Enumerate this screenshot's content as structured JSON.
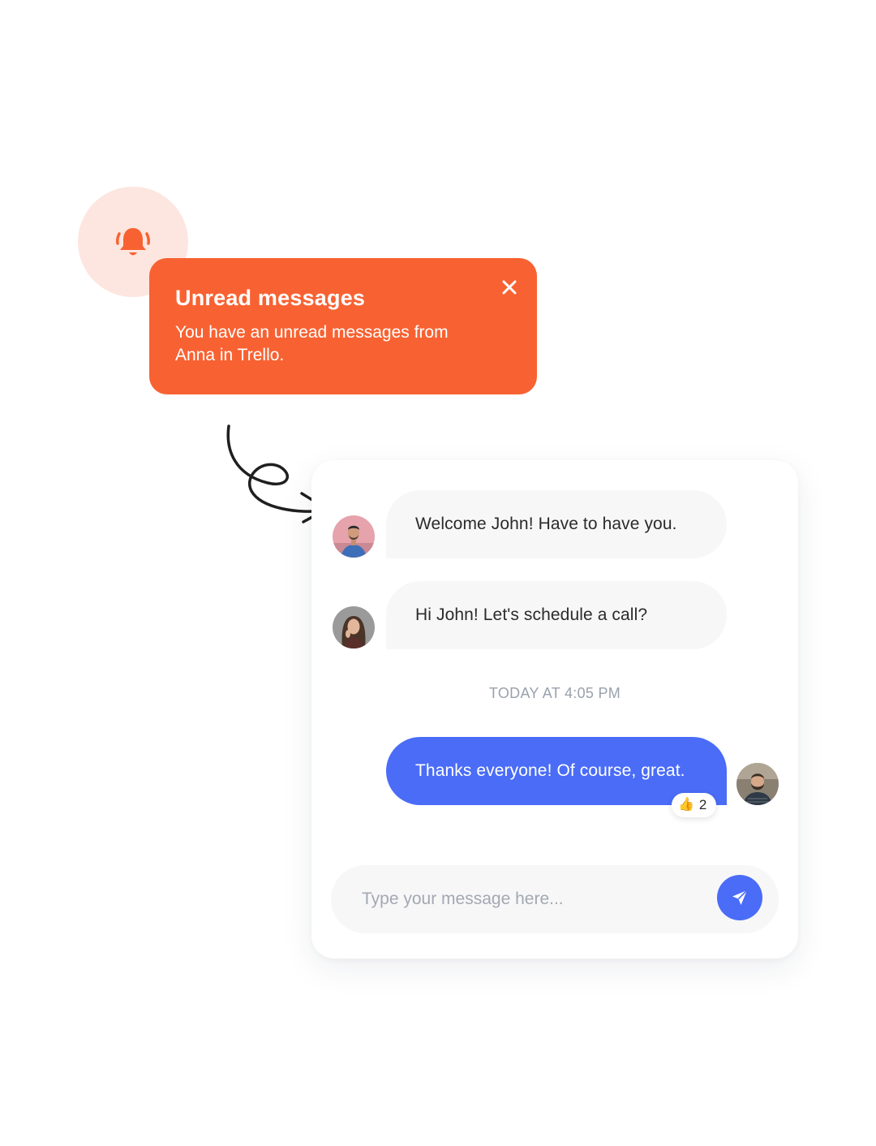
{
  "notification": {
    "title": "Unread messages",
    "body": "You have an unread messages from Anna in Trello.",
    "icon": "bell-ring-icon",
    "close_icon": "close-icon",
    "accent_color": "#f86232",
    "bell_bg_color": "#fde6df"
  },
  "chat": {
    "messages": [
      {
        "sender": "other",
        "avatar": "avatar-man-pink-bg",
        "text": "Welcome John! Have to have you."
      },
      {
        "sender": "other",
        "avatar": "avatar-woman",
        "text": "Hi John! Let's schedule a call?"
      }
    ],
    "timestamp": "TODAY AT 4:05 PM",
    "own_message": {
      "text": "Thanks everyone! Of course, great.",
      "avatar": "avatar-man-beard",
      "reaction": {
        "emoji": "👍",
        "count": "2"
      }
    },
    "composer": {
      "placeholder": "Type your message here...",
      "value": "",
      "send_icon": "send-icon"
    },
    "colors": {
      "own_bubble": "#4a6cf7",
      "other_bubble": "#f7f7f8",
      "timestamp": "#9aa1ac"
    }
  }
}
